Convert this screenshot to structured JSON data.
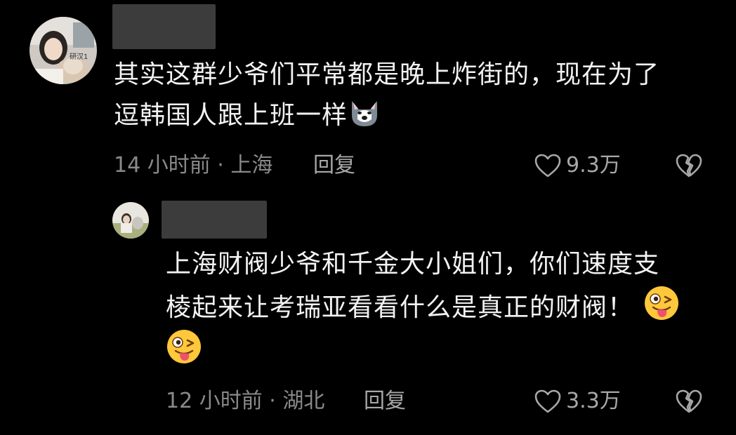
{
  "comments": [
    {
      "author_name": "",
      "text_line1": "其实这群少爷们平常都是晚上炸街的，现在为了",
      "text_line2": "逗韩国人跟上班一样",
      "time_location": "14 小时前 · 上海",
      "reply_label": "回复",
      "like_count": "9.3万",
      "emoji": "husky-doge-emoji",
      "avatar_badge": "研汉1"
    },
    {
      "author_name": "",
      "text_line1": "上海财阀少爷和千金大小姐们，你们速度支",
      "text_line2": "棱起来让考瑞亚看看什么是真正的财阀！",
      "time_location": "12 小时前 · 湖北",
      "reply_label": "回复",
      "like_count": "3.3万",
      "emoji": "winking-tongue-emoji"
    }
  ],
  "colors": {
    "background": "#000000",
    "text": "#f2f2f2",
    "meta": "#8a8a8a",
    "redaction": "#3c3c3c"
  }
}
